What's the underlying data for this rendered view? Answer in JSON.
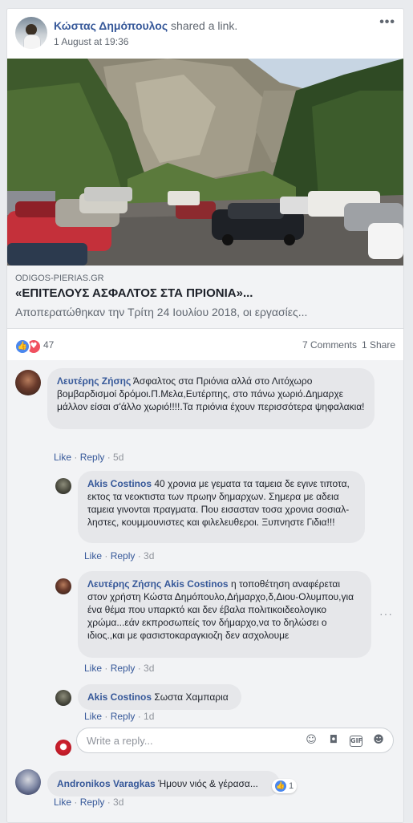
{
  "post": {
    "author": "Κώστας Δημόπουλος",
    "action": "shared a link.",
    "date": "1 August at 19:36",
    "more_icon": "more-options-icon",
    "link": {
      "domain": "ODIGOS-PIERIAS.GR",
      "title": "«ΕΠΙΤΕΛΟΥΣ ΑΣΦΑΛΤΟΣ ΣΤΑ ΠΡΙΟΝΙΑ»...",
      "description": "Αποπερατώθηκαν την Τρίτη 24 Ιουλίου 2018, οι εργασίες..."
    },
    "stats": {
      "reactions": "47",
      "comments": "7 Comments",
      "shares": "1 Share"
    }
  },
  "comments": [
    {
      "name": "Λευτέρης Ζήσης",
      "text": "Άσφαλτος στα Πριόνια αλλά στο Λιτόχωρο βομβαρδισμοί δρόμοι.Π.Μελα,Ευτέρπης, στο πάνω χωριό.Δημαρχε μάλλον είσαι σ'άλλο χωριό!!!!.Τα πριόνια έχουν περισσότερα ψηφαλακια!",
      "like": "Like",
      "reply": "Reply",
      "time": "5d"
    },
    {
      "name": "Akis Costinos",
      "text": "40 χρονια με γεματα τα ταμεια δε εγινε τιποτα, εκτος τα νεοκτιστα των πρωην δημαρχων. Σημερα με αδεια ταμεια γινονται πραγματα. Που εισασταν τοσα χρονια σοσιαλ-ληστες, κουμμουνιστες και φιλελευθεροι. Ξυπνηστε Γιδια!!!",
      "like": "Like",
      "reply": "Reply",
      "time": "3d"
    },
    {
      "name": "Λευτέρης Ζήσης",
      "tag": "Akis Costinos",
      "text": "η τοποθέτηση αναφέρεται στον χρήστη Κώστα Δημόπουλο,Δήμαρχο,δ,Διου-Ολυμπου,για ένα θέμα που υπαρκτό και δεν έβαλα πολιτικοιδεολογικο χρώμα...εάν εκπροσωπείς τον δήμαρχο,να το δηλώσει ο ιδιος.,και με φασιστοκαραγκιοζη δεν ασχολουμε",
      "like": "Like",
      "reply": "Reply",
      "time": "3d"
    },
    {
      "name": "Akis Costinos",
      "text": "Σωστα Χαμπαρια",
      "like": "Like",
      "reply": "Reply",
      "time": "1d"
    },
    {
      "name": "Andronikos Varagkas",
      "text": "Ήμουν νιός & γέρασα...",
      "like": "Like",
      "reply": "Reply",
      "time": "3d",
      "reactions": "1"
    }
  ],
  "reply_box": {
    "placeholder": "Write a reply...",
    "icons": [
      "emoji-icon",
      "camera-icon",
      "gif-icon",
      "sticker-icon"
    ]
  },
  "colors": {
    "link_blue": "#365899",
    "like_blue": "#4a87ee",
    "love_red": "#f0505f"
  }
}
